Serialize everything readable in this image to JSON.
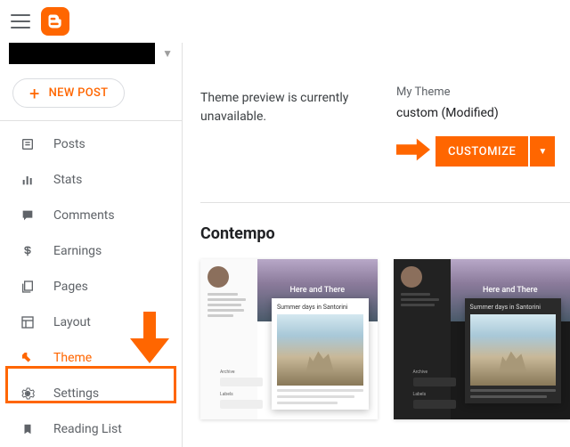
{
  "sidebar": {
    "new_post": "NEW POST",
    "items": [
      {
        "label": "Posts"
      },
      {
        "label": "Stats"
      },
      {
        "label": "Comments"
      },
      {
        "label": "Earnings"
      },
      {
        "label": "Pages"
      },
      {
        "label": "Layout"
      },
      {
        "label": "Theme"
      },
      {
        "label": "Settings"
      },
      {
        "label": "Reading List"
      }
    ]
  },
  "main": {
    "preview_msg": "Theme preview is currently unavailable.",
    "my_theme_label": "My Theme",
    "theme_name": "custom (Modified)",
    "customize": "CUSTOMIZE",
    "section_title": "Contempo",
    "card_hero_title": "Here and There",
    "card_post_title": "Summer days in Santorini",
    "side_archive": "Archive",
    "side_labels": "Labels"
  }
}
